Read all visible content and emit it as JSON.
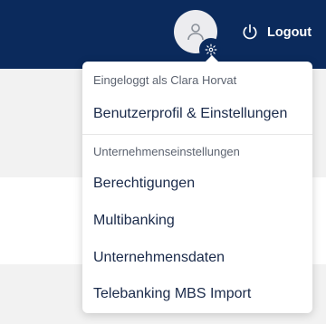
{
  "header": {
    "logout_label": "Logout",
    "avatar_icon": "user-icon",
    "badge_icon": "gear-icon",
    "logout_icon": "power-icon"
  },
  "menu": {
    "logged_in_as": "Eingeloggt als Clara Horvat",
    "profile_item": "Benutzerprofil & Einstellungen",
    "company_section": "Unternehmenseinstellungen",
    "items": [
      "Berechtigungen",
      "Multibanking",
      "Unternehmensdaten",
      "Telebanking MBS Import"
    ]
  },
  "colors": {
    "header_bg": "#0b2a5c",
    "menu_text": "#1a2a4a",
    "section_text": "#5c6370"
  }
}
